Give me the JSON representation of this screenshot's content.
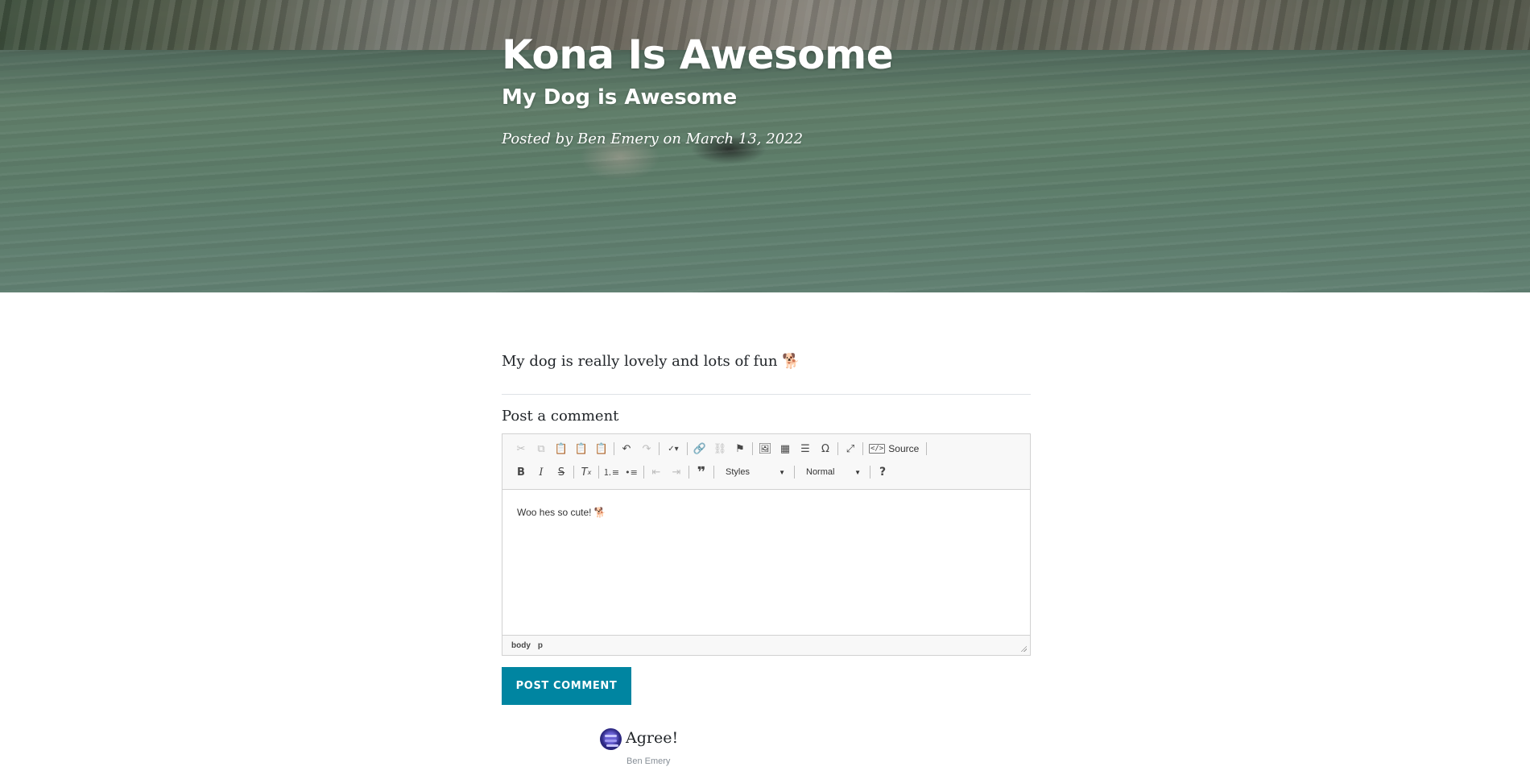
{
  "post": {
    "title": "Kona Is Awesome",
    "subtitle": "My Dog is Awesome",
    "meta": "Posted by Ben Emery on March 13, 2022",
    "body": "My dog is really lovely and lots of fun 🐕"
  },
  "comment_form": {
    "heading": "Post a comment",
    "editor_content": "Woo hes so cute! 🐕",
    "toolbar": {
      "source_label": "Source",
      "styles_label": "Styles",
      "format_label": "Normal",
      "help_label": "?"
    },
    "element_path": [
      "body",
      "p"
    ],
    "submit_label": "POST COMMENT"
  },
  "comments": [
    {
      "text": "Agree!",
      "author": "Ben Emery"
    }
  ],
  "colors": {
    "accent": "#0085a1",
    "text": "#212529",
    "muted": "#868e96",
    "toolbar_bg": "#f8f8f8",
    "border": "#d1d1d1"
  }
}
